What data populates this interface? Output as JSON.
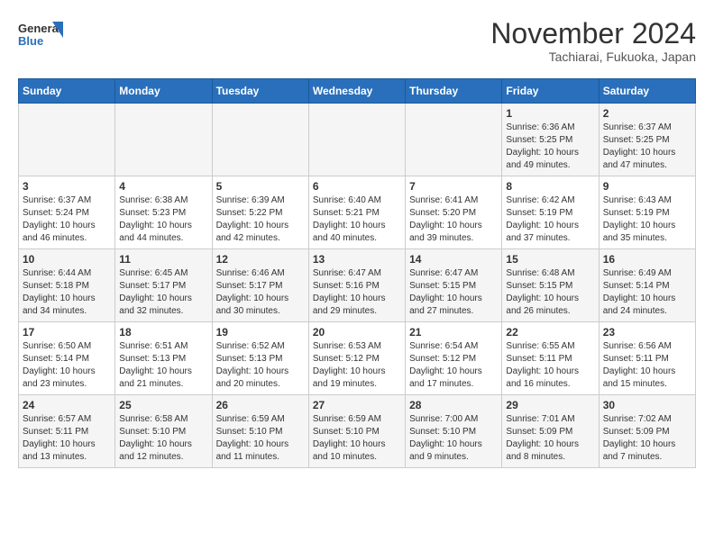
{
  "logo": {
    "line1": "General",
    "line2": "Blue"
  },
  "title": "November 2024",
  "subtitle": "Tachiarai, Fukuoka, Japan",
  "headers": [
    "Sunday",
    "Monday",
    "Tuesday",
    "Wednesday",
    "Thursday",
    "Friday",
    "Saturday"
  ],
  "weeks": [
    [
      {
        "day": "",
        "info": ""
      },
      {
        "day": "",
        "info": ""
      },
      {
        "day": "",
        "info": ""
      },
      {
        "day": "",
        "info": ""
      },
      {
        "day": "",
        "info": ""
      },
      {
        "day": "1",
        "info": "Sunrise: 6:36 AM\nSunset: 5:25 PM\nDaylight: 10 hours\nand 49 minutes."
      },
      {
        "day": "2",
        "info": "Sunrise: 6:37 AM\nSunset: 5:25 PM\nDaylight: 10 hours\nand 47 minutes."
      }
    ],
    [
      {
        "day": "3",
        "info": "Sunrise: 6:37 AM\nSunset: 5:24 PM\nDaylight: 10 hours\nand 46 minutes."
      },
      {
        "day": "4",
        "info": "Sunrise: 6:38 AM\nSunset: 5:23 PM\nDaylight: 10 hours\nand 44 minutes."
      },
      {
        "day": "5",
        "info": "Sunrise: 6:39 AM\nSunset: 5:22 PM\nDaylight: 10 hours\nand 42 minutes."
      },
      {
        "day": "6",
        "info": "Sunrise: 6:40 AM\nSunset: 5:21 PM\nDaylight: 10 hours\nand 40 minutes."
      },
      {
        "day": "7",
        "info": "Sunrise: 6:41 AM\nSunset: 5:20 PM\nDaylight: 10 hours\nand 39 minutes."
      },
      {
        "day": "8",
        "info": "Sunrise: 6:42 AM\nSunset: 5:19 PM\nDaylight: 10 hours\nand 37 minutes."
      },
      {
        "day": "9",
        "info": "Sunrise: 6:43 AM\nSunset: 5:19 PM\nDaylight: 10 hours\nand 35 minutes."
      }
    ],
    [
      {
        "day": "10",
        "info": "Sunrise: 6:44 AM\nSunset: 5:18 PM\nDaylight: 10 hours\nand 34 minutes."
      },
      {
        "day": "11",
        "info": "Sunrise: 6:45 AM\nSunset: 5:17 PM\nDaylight: 10 hours\nand 32 minutes."
      },
      {
        "day": "12",
        "info": "Sunrise: 6:46 AM\nSunset: 5:17 PM\nDaylight: 10 hours\nand 30 minutes."
      },
      {
        "day": "13",
        "info": "Sunrise: 6:47 AM\nSunset: 5:16 PM\nDaylight: 10 hours\nand 29 minutes."
      },
      {
        "day": "14",
        "info": "Sunrise: 6:47 AM\nSunset: 5:15 PM\nDaylight: 10 hours\nand 27 minutes."
      },
      {
        "day": "15",
        "info": "Sunrise: 6:48 AM\nSunset: 5:15 PM\nDaylight: 10 hours\nand 26 minutes."
      },
      {
        "day": "16",
        "info": "Sunrise: 6:49 AM\nSunset: 5:14 PM\nDaylight: 10 hours\nand 24 minutes."
      }
    ],
    [
      {
        "day": "17",
        "info": "Sunrise: 6:50 AM\nSunset: 5:14 PM\nDaylight: 10 hours\nand 23 minutes."
      },
      {
        "day": "18",
        "info": "Sunrise: 6:51 AM\nSunset: 5:13 PM\nDaylight: 10 hours\nand 21 minutes."
      },
      {
        "day": "19",
        "info": "Sunrise: 6:52 AM\nSunset: 5:13 PM\nDaylight: 10 hours\nand 20 minutes."
      },
      {
        "day": "20",
        "info": "Sunrise: 6:53 AM\nSunset: 5:12 PM\nDaylight: 10 hours\nand 19 minutes."
      },
      {
        "day": "21",
        "info": "Sunrise: 6:54 AM\nSunset: 5:12 PM\nDaylight: 10 hours\nand 17 minutes."
      },
      {
        "day": "22",
        "info": "Sunrise: 6:55 AM\nSunset: 5:11 PM\nDaylight: 10 hours\nand 16 minutes."
      },
      {
        "day": "23",
        "info": "Sunrise: 6:56 AM\nSunset: 5:11 PM\nDaylight: 10 hours\nand 15 minutes."
      }
    ],
    [
      {
        "day": "24",
        "info": "Sunrise: 6:57 AM\nSunset: 5:11 PM\nDaylight: 10 hours\nand 13 minutes."
      },
      {
        "day": "25",
        "info": "Sunrise: 6:58 AM\nSunset: 5:10 PM\nDaylight: 10 hours\nand 12 minutes."
      },
      {
        "day": "26",
        "info": "Sunrise: 6:59 AM\nSunset: 5:10 PM\nDaylight: 10 hours\nand 11 minutes."
      },
      {
        "day": "27",
        "info": "Sunrise: 6:59 AM\nSunset: 5:10 PM\nDaylight: 10 hours\nand 10 minutes."
      },
      {
        "day": "28",
        "info": "Sunrise: 7:00 AM\nSunset: 5:10 PM\nDaylight: 10 hours\nand 9 minutes."
      },
      {
        "day": "29",
        "info": "Sunrise: 7:01 AM\nSunset: 5:09 PM\nDaylight: 10 hours\nand 8 minutes."
      },
      {
        "day": "30",
        "info": "Sunrise: 7:02 AM\nSunset: 5:09 PM\nDaylight: 10 hours\nand 7 minutes."
      }
    ]
  ]
}
